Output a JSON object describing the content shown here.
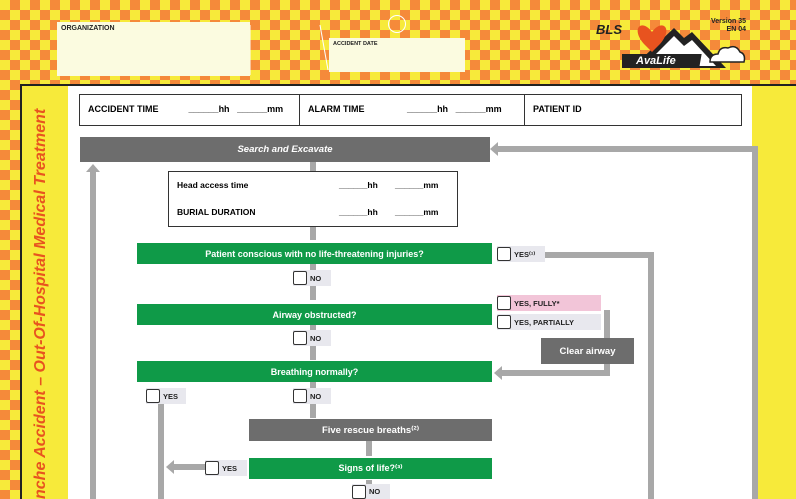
{
  "header": {
    "organization_label": "ORGANIZATION",
    "accident_date_label": "ACCIDENT DATE",
    "protocol": "BLS",
    "version": "Version 35",
    "edition": "EN 04",
    "logo_text": "AvaLife"
  },
  "sidebar_title": "nche Accident – Out-Of-Hospital Medical Treatment",
  "timebar": {
    "accident_time": "ACCIDENT TIME",
    "alarm_time": "ALARM TIME",
    "patient_id": "PATIENT ID",
    "hh": "hh",
    "mm": "mm",
    "blank": "______"
  },
  "flow": {
    "search": "Search and Excavate",
    "head_access": "Head access time",
    "burial_duration": "BURIAL DURATION",
    "q1": "Patient conscious with no life-threatening injuries?",
    "q1_yes": "YES⁽¹⁾",
    "q1_no": "NO",
    "q2": "Airway obstructed?",
    "q2_yes_fully": "YES, FULLY*",
    "q2_yes_partially": "YES, PARTIALLY",
    "q2_no": "NO",
    "clear_airway": "Clear airway",
    "q3": "Breathing normally?",
    "q3_yes": "YES",
    "q3_no": "NO",
    "rescue_breaths": "Five rescue breaths⁽²⁾",
    "q4": "Signs of life?⁽³⁾",
    "q4_yes": "YES",
    "q4_no": "NO"
  },
  "colors": {
    "orange": "#f58a3a",
    "yellow": "#f7ea3a",
    "green": "#0f9a48",
    "grey": "#6d6d6d",
    "accent": "#e8531f"
  }
}
